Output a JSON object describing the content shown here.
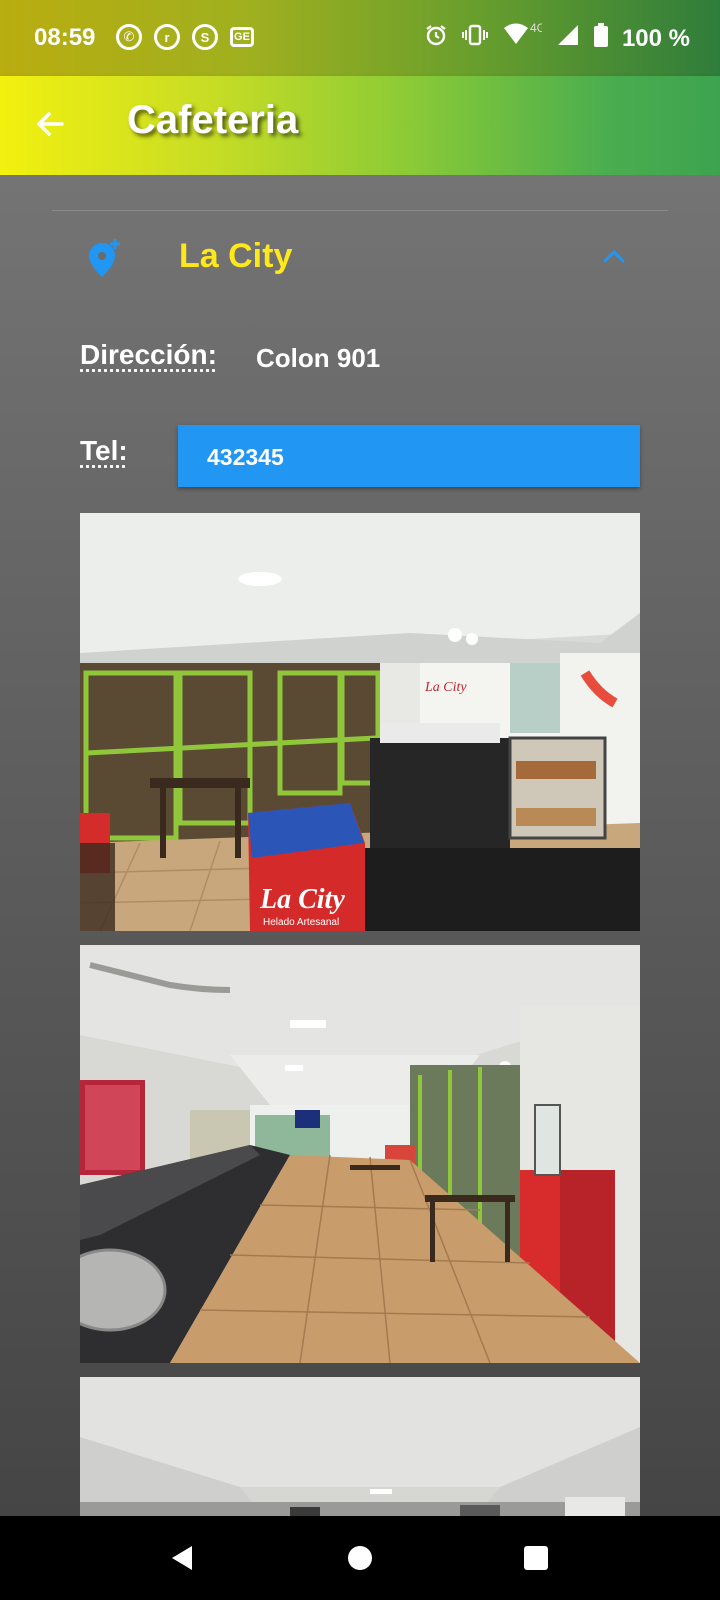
{
  "status_bar": {
    "time": "08:59",
    "notification_icons": [
      "whatsapp-icon",
      "rappi-icon",
      "shazam-icon",
      "ge-icon"
    ],
    "network": "4G",
    "battery": "100 %"
  },
  "app_bar": {
    "title": "Cafeteria",
    "back_icon": "arrow-left-icon"
  },
  "place": {
    "name": "La City",
    "icon": "add-location-icon",
    "expanded": true,
    "address_label": "Dirección:",
    "address_value": "Colon 901",
    "tel_label": "Tel:",
    "tel_value": "432345",
    "photos": [
      {
        "name": "cafeteria-photo-1"
      },
      {
        "name": "cafeteria-photo-2"
      },
      {
        "name": "cafeteria-photo-3"
      }
    ],
    "photo_signs": [
      "La City",
      "Helado Artesanal"
    ]
  },
  "colors": {
    "accent_yellow": "#ffe81a",
    "field_blue": "#2196f3",
    "chevron_blue": "#2196f3"
  },
  "nav_bar": {
    "buttons": [
      "back-triangle-icon",
      "home-circle-icon",
      "recents-square-icon"
    ]
  }
}
